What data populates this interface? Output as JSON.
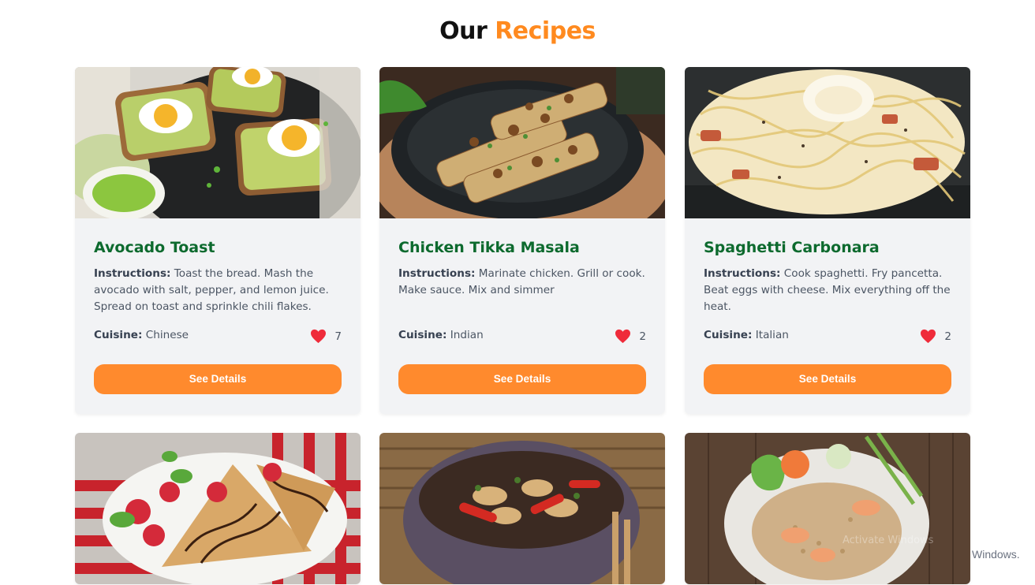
{
  "header": {
    "title_part1": "Our",
    "title_part2": "Recipes"
  },
  "labels": {
    "instructions": "Instructions:",
    "cuisine": "Cuisine:",
    "details_button": "See Details"
  },
  "recipes": [
    {
      "name": "Avocado Toast",
      "instructions": "Toast the bread. Mash the avocado with salt, pepper, and lemon juice. Spread on toast and sprinkle chili flakes.",
      "cuisine": "Chinese",
      "likes": "7",
      "photo_icon": "avocado-toast-photo"
    },
    {
      "name": "Chicken Tikka Masala",
      "instructions": "Marinate chicken. Grill or cook. Make sauce. Mix and simmer",
      "cuisine": "Indian",
      "likes": "2",
      "photo_icon": "chicken-skewers-photo"
    },
    {
      "name": "Spaghetti Carbonara",
      "instructions": "Cook spaghetti. Fry pancetta. Beat eggs with cheese. Mix everything off the heat.",
      "cuisine": "Italian",
      "likes": "2",
      "photo_icon": "spaghetti-photo"
    },
    {
      "photo_icon": "crepes-strawberries-photo"
    },
    {
      "photo_icon": "stir-fry-bowl-photo"
    },
    {
      "photo_icon": "shrimp-fried-rice-photo"
    }
  ],
  "colors": {
    "accent": "#ff8a1f",
    "title_green": "#0d6a2e",
    "button": "#ff8a2d",
    "heart": "#ef2b3a",
    "card_bg": "#f2f3f5"
  },
  "watermark": "Windows."
}
